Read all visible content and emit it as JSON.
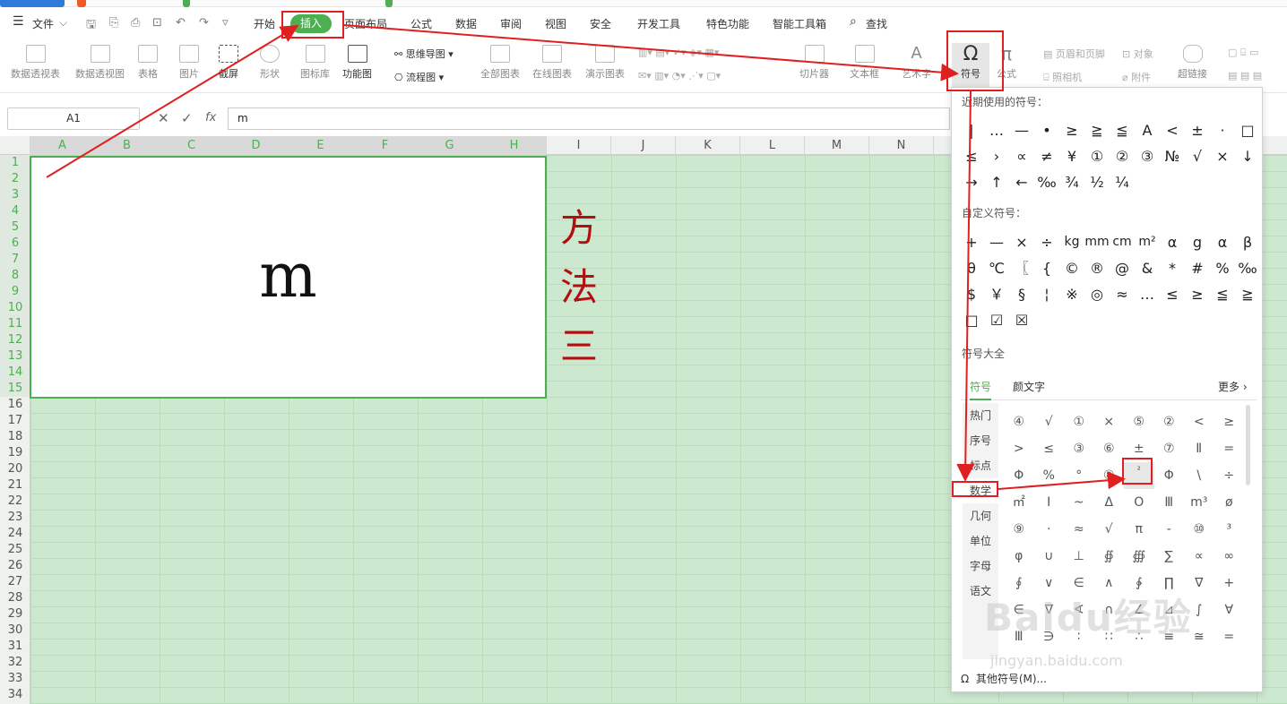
{
  "menubar": {
    "file_label": "文件",
    "tabs": [
      "开始",
      "插入",
      "页面布局",
      "公式",
      "数据",
      "审阅",
      "视图",
      "安全",
      "开发工具",
      "特色功能",
      "智能工具箱"
    ],
    "search_label": "查找"
  },
  "ribbon": {
    "items": [
      "数据透视表",
      "数据透视图",
      "表格",
      "图片",
      "截屏",
      "形状",
      "图标库",
      "功能图",
      "思维导图",
      "流程图",
      "全部图表",
      "在线图表",
      "演示图表",
      "切片器",
      "文本框",
      "艺术字",
      "符号",
      "公式",
      "页眉和页脚",
      "对象",
      "照相机",
      "附件",
      "超链接"
    ]
  },
  "formula": {
    "cell_ref": "A1",
    "fx": "fx",
    "value": "m"
  },
  "columns": [
    "A",
    "B",
    "C",
    "D",
    "E",
    "F",
    "G",
    "H",
    "I",
    "J",
    "K",
    "L",
    "M",
    "N"
  ],
  "rows": [
    "1",
    "2",
    "3",
    "4",
    "5",
    "6",
    "7",
    "8",
    "9",
    "10",
    "11",
    "12",
    "13",
    "14",
    "15",
    "16",
    "17",
    "18",
    "19",
    "20",
    "21",
    "22",
    "23",
    "24",
    "25",
    "26",
    "27",
    "28",
    "29",
    "30",
    "31",
    "32",
    "33",
    "34"
  ],
  "cell_text": "m",
  "side_text": [
    "方",
    "法",
    "三"
  ],
  "panel": {
    "recent_title": "近期使用的符号：",
    "recent": [
      "|",
      "…",
      "—",
      "•",
      "≥",
      "≧",
      "≦",
      "A",
      "<",
      "±",
      "·",
      "□",
      "≤",
      "›",
      "∝",
      "≠",
      "¥",
      "①",
      "②",
      "③",
      "№",
      "√",
      "×",
      "↓",
      "→",
      "↑",
      "←",
      "‰",
      "¾",
      "½",
      "¼"
    ],
    "custom_title": "自定义符号：",
    "custom": [
      "+",
      "—",
      "×",
      "÷",
      "kg",
      "mm",
      "cm",
      "m²",
      "α",
      "g",
      "α",
      "β",
      "θ",
      "℃",
      "〖",
      "{",
      "©",
      "®",
      "@",
      "&",
      "*",
      "#",
      "%",
      "‰",
      "$",
      "￥",
      "§",
      "¦",
      "※",
      "◎",
      "≈",
      "…",
      "≤",
      "≥",
      "≦",
      "≧",
      "□",
      "☑",
      "☒"
    ],
    "all_title": "符号大全",
    "tab_symbols": "符号",
    "tab_kaomoji": "颜文字",
    "more": "更多",
    "categories": [
      "热门",
      "序号",
      "标点",
      "数学",
      "几何",
      "单位",
      "字母",
      "语文"
    ],
    "math": [
      "④",
      "√",
      "①",
      "×",
      "⑤",
      "②",
      "<",
      "≥",
      ">",
      "≤",
      "③",
      "⑥",
      "±",
      "⑦",
      "Ⅱ",
      "=",
      "Φ",
      "%",
      "°",
      "⑧",
      "²",
      "Φ",
      "\\",
      "÷",
      "㎡",
      "Ⅰ",
      "~",
      "Δ",
      "O",
      "Ⅲ",
      "m³",
      "ø",
      "⑨",
      "·",
      "≈",
      "√",
      "π",
      "-",
      "⑩",
      "³",
      "φ",
      "∪",
      "⊥",
      "∯",
      "∰",
      "∑",
      "∝",
      "∞",
      "∮",
      "∨",
      "∈",
      "∧",
      "∲",
      "∏",
      "∇",
      "+",
      "∈",
      "∇",
      "∢",
      "∩",
      "∠",
      "⊿",
      "∫",
      "∀",
      "Ⅲ",
      "∋",
      "∶",
      "∷",
      "∴",
      "≡",
      "≅",
      "="
    ],
    "other_label": "其他符号(M)..."
  },
  "watermark": {
    "logo": "Baidu经验",
    "url": "jingyan.baidu.com"
  }
}
